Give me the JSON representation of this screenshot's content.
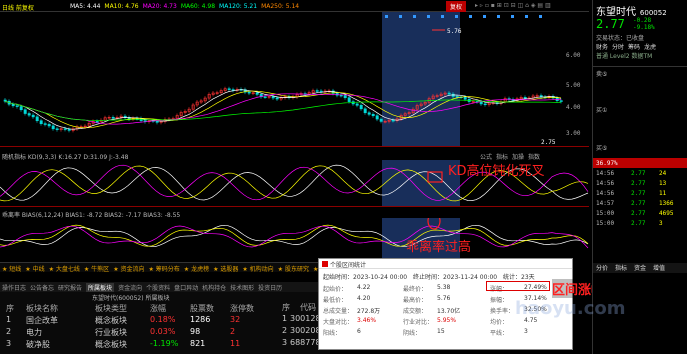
{
  "stock": {
    "name": "东望时代",
    "code": "600052",
    "price": "2.77",
    "change": "-0.28",
    "change_pct": "-9.18%",
    "status": "交易状态：已收盘",
    "level2": "普通 Level2 数据TM",
    "sell_label": "卖⑤",
    "buy_label": "买⑤",
    "red_box_pct": "36.97%",
    "mini_tabs": [
      "财务",
      "分时",
      "筹码",
      "龙虎"
    ],
    "trades": [
      {
        "time": "14:56",
        "price": "2.77",
        "vol": "24"
      },
      {
        "time": "14:56",
        "price": "2.77",
        "vol": "13"
      },
      {
        "time": "14:56",
        "price": "2.77",
        "vol": "11"
      },
      {
        "time": "14:57",
        "price": "2.77",
        "vol": "1366"
      },
      {
        "time": "15:00",
        "price": "2.77",
        "vol": "4695"
      },
      {
        "time": "15:00",
        "price": "2.77",
        "vol": "3"
      }
    ],
    "bottom_tabs": [
      "分价",
      "指标",
      "资金",
      "增值"
    ]
  },
  "chart": {
    "header_left": "日线 前复权",
    "ma_labels": [
      "MA5: 4.44",
      "MA10: 4.76",
      "MA20: 4.73",
      "MA60: 4.98",
      "MA120: 5.21",
      "MA250: 5.14"
    ],
    "period_btn": "复权",
    "high_label": "5.76",
    "low_label": "2.75",
    "y_axis": [
      "6.00",
      "5.00",
      "4.00",
      "3.00"
    ],
    "kd_header": "随机指标 KD(9,3,3)   K:16.27   D:31.09   J:-3.48",
    "kd_tools": [
      "公式",
      "指标",
      "加操",
      "指数"
    ],
    "kd_annotation": "KD高位钝化死叉",
    "bias_header": "乖离率 BIAS(6,12,24)   BIAS1: -8.72   BIAS2: -7.17   BIAS3: -8.55",
    "bias_annotation": "乖离率过高",
    "range_annotation": "区间涨幅满足"
  },
  "toolbar_tabs": [
    "操作日志",
    "公告备忘",
    "研究报告",
    "所属板块",
    "资金流向",
    "个股资料",
    "盘口异动",
    "机构持仓",
    "技术图形",
    "投资日历"
  ],
  "signals": [
    "★ 短线",
    "★ 中线",
    "★ 大盘七线",
    "★ 牛熊区",
    "★ 资金流向",
    "★ 筹码分布",
    "★ 龙虎榜",
    "★ 选股器",
    "★ 机构动向",
    "★ 股东研究",
    "★ 板块"
  ],
  "sector_header": "东望时代(600052) 所属板块",
  "sector_cols": [
    "序",
    "板块名称",
    "板块类型",
    "涨幅",
    "股票数",
    "涨停数"
  ],
  "sectors": [
    {
      "no": "1",
      "name": "国企改革",
      "type": "概念板块",
      "pct": "0.18%",
      "count": "1286",
      "limit": "32"
    },
    {
      "no": "2",
      "name": "电力",
      "type": "行业板块",
      "pct": "0.03%",
      "count": "98",
      "limit": "2"
    },
    {
      "no": "3",
      "name": "破净股",
      "type": "概念板块",
      "pct": "-1.19%",
      "count": "821",
      "limit": "11"
    }
  ],
  "right_cols": [
    "序",
    "代码"
  ],
  "right_rows": [
    {
      "no": "1",
      "code": "300128"
    },
    {
      "no": "2",
      "code": "300208"
    },
    {
      "no": "3",
      "code": "688778"
    }
  ],
  "popup": {
    "title": "个股区间统计",
    "start_label": "起始时间：",
    "start": "2023-10-24 00:00",
    "end_label": "终止时间：",
    "end": "2023-11-24 00:00",
    "days_label": "统计：",
    "days": "23天",
    "rows": [
      {
        "label": "起始价：",
        "value": "4.22",
        "label2": "最终价：",
        "value2": "5.38",
        "label3": "涨幅：",
        "value3": "27.49%"
      },
      {
        "label": "最低价：",
        "value": "4.20",
        "label2": "最高价：",
        "value2": "5.76",
        "label3": "振幅：",
        "value3": "37.14%"
      },
      {
        "label": "总成交量：",
        "value": "272.8万",
        "label2": "成交额：",
        "value2": "13.70亿",
        "label3": "换手率：",
        "value3": "32.50%"
      },
      {
        "label": "大盘对比：",
        "value": "3.46%",
        "label2": "行业对比：",
        "value2": "5.95%",
        "label3": "均价：",
        "value3": "4.75"
      },
      {
        "label": "阳线：",
        "value": "6",
        "label2": "阴线：",
        "value2": "15",
        "label3": "平线：",
        "value3": "3"
      }
    ]
  },
  "watermark": "haoyu.com",
  "colors": {
    "up": "#ff3232",
    "down": "#00e600",
    "accent": "#e0e000",
    "highlight": "#2a4a8a"
  }
}
